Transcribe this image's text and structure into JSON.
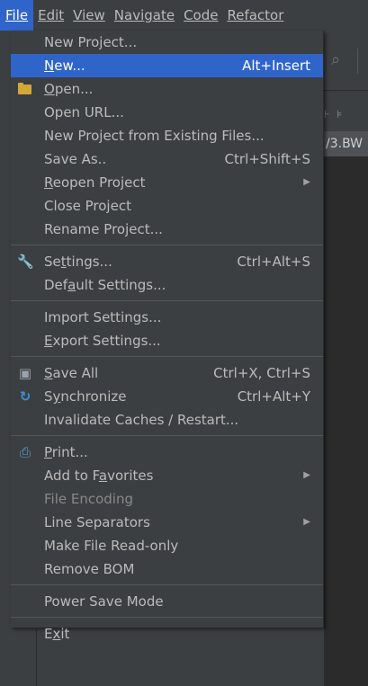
{
  "menubar": {
    "items": [
      {
        "label": "File",
        "mnemonic_index": 0
      },
      {
        "label": "Edit",
        "mnemonic_index": 0
      },
      {
        "label": "View",
        "mnemonic_index": 0
      },
      {
        "label": "Navigate",
        "mnemonic_index": 0
      },
      {
        "label": "Code",
        "mnemonic_index": 0
      },
      {
        "label": "Refactor",
        "mnemonic_index": 0
      }
    ]
  },
  "background": {
    "tab_label": "/3.BW"
  },
  "file_menu": {
    "items": [
      {
        "label": "New Project...",
        "shortcut": ""
      },
      {
        "label": "New...",
        "shortcut": "Alt+Insert",
        "selected": true
      },
      {
        "label": "Open...",
        "shortcut": "",
        "icon": "folder-icon"
      },
      {
        "label": "Open URL...",
        "shortcut": ""
      },
      {
        "label": "New Project from Existing Files...",
        "shortcut": ""
      },
      {
        "label": "Save As..",
        "shortcut": "Ctrl+Shift+S"
      },
      {
        "label": "Reopen Project",
        "shortcut": "",
        "submenu": true
      },
      {
        "label": "Close Project",
        "shortcut": ""
      },
      {
        "label": "Rename Project...",
        "shortcut": ""
      },
      {
        "label": "Settings...",
        "shortcut": "Ctrl+Alt+S",
        "icon": "wrench-icon"
      },
      {
        "label": "Default Settings...",
        "shortcut": ""
      },
      {
        "label": "Import Settings...",
        "shortcut": ""
      },
      {
        "label": "Export Settings...",
        "shortcut": ""
      },
      {
        "label": "Save All",
        "shortcut": "Ctrl+X, Ctrl+S",
        "icon": "save-all-icon"
      },
      {
        "label": "Synchronize",
        "shortcut": "Ctrl+Alt+Y",
        "icon": "sync-icon"
      },
      {
        "label": "Invalidate Caches / Restart...",
        "shortcut": ""
      },
      {
        "label": "Print...",
        "shortcut": "",
        "icon": "print-icon"
      },
      {
        "label": "Add to Favorites",
        "shortcut": "",
        "submenu": true
      },
      {
        "label": "File Encoding",
        "shortcut": "",
        "disabled": true
      },
      {
        "label": "Line Separators",
        "shortcut": "",
        "submenu": true
      },
      {
        "label": "Make File Read-only",
        "shortcut": ""
      },
      {
        "label": "Remove BOM",
        "shortcut": ""
      },
      {
        "label": "Power Save Mode",
        "shortcut": ""
      },
      {
        "label": "Exit",
        "shortcut": ""
      }
    ]
  },
  "colors": {
    "selection": "#2f65ca",
    "menu_bg": "#3c3f41",
    "editor_bg": "#2b2b2b",
    "text": "#bbbbbb",
    "disabled_text": "#888888"
  }
}
